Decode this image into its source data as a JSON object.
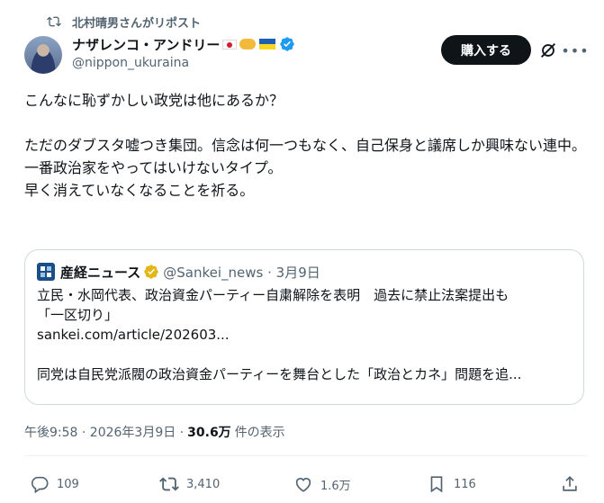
{
  "repost": {
    "label": "北村晴男さんがリポスト"
  },
  "author": {
    "display_name": "ナザレンコ・アンドリー",
    "handle": "@nippon_ukuraina"
  },
  "header": {
    "buy_label": "購入する"
  },
  "tweet": {
    "text": "こんなに恥ずかしい政党は他にあるか？\n\nただのダブスタ嘘つき集団。信念は何一つもなく、自己保身と議席しか興味ない連中。\n一番政治家をやってはいけないタイプ。\n早く消えていなくなることを祈る。"
  },
  "quote": {
    "name": "産経ニュース",
    "handle_date": "@Sankei_news · 3月9日",
    "headline_1": "立民・水岡代表、政治資金パーティー自粛解除を表明　過去に禁止法案提出も",
    "headline_2": "「一区切り」",
    "link": "sankei.com/article/202603...",
    "summary": "同党は自民党派閥の政治資金パーティーを舞台とした「政治とカネ」問題を追..."
  },
  "meta": {
    "time_date": "午後9:58 · 2026年3月9日 ·",
    "views": "30.6万",
    "views_label": "件の表示"
  },
  "actions": {
    "replies": "109",
    "reposts": "3,410",
    "likes": "1.6万",
    "bookmarks": "116"
  },
  "icons": [
    "repost-icon",
    "verified-badge-icon",
    "grok-icon",
    "more-icon",
    "reply-icon",
    "like-icon",
    "bookmark-icon",
    "share-icon"
  ],
  "colors": {
    "verified": "#1d9bf0",
    "muted": "#536471",
    "text": "#0f1419",
    "button": "#0f1419",
    "border": "#cfd9de"
  }
}
